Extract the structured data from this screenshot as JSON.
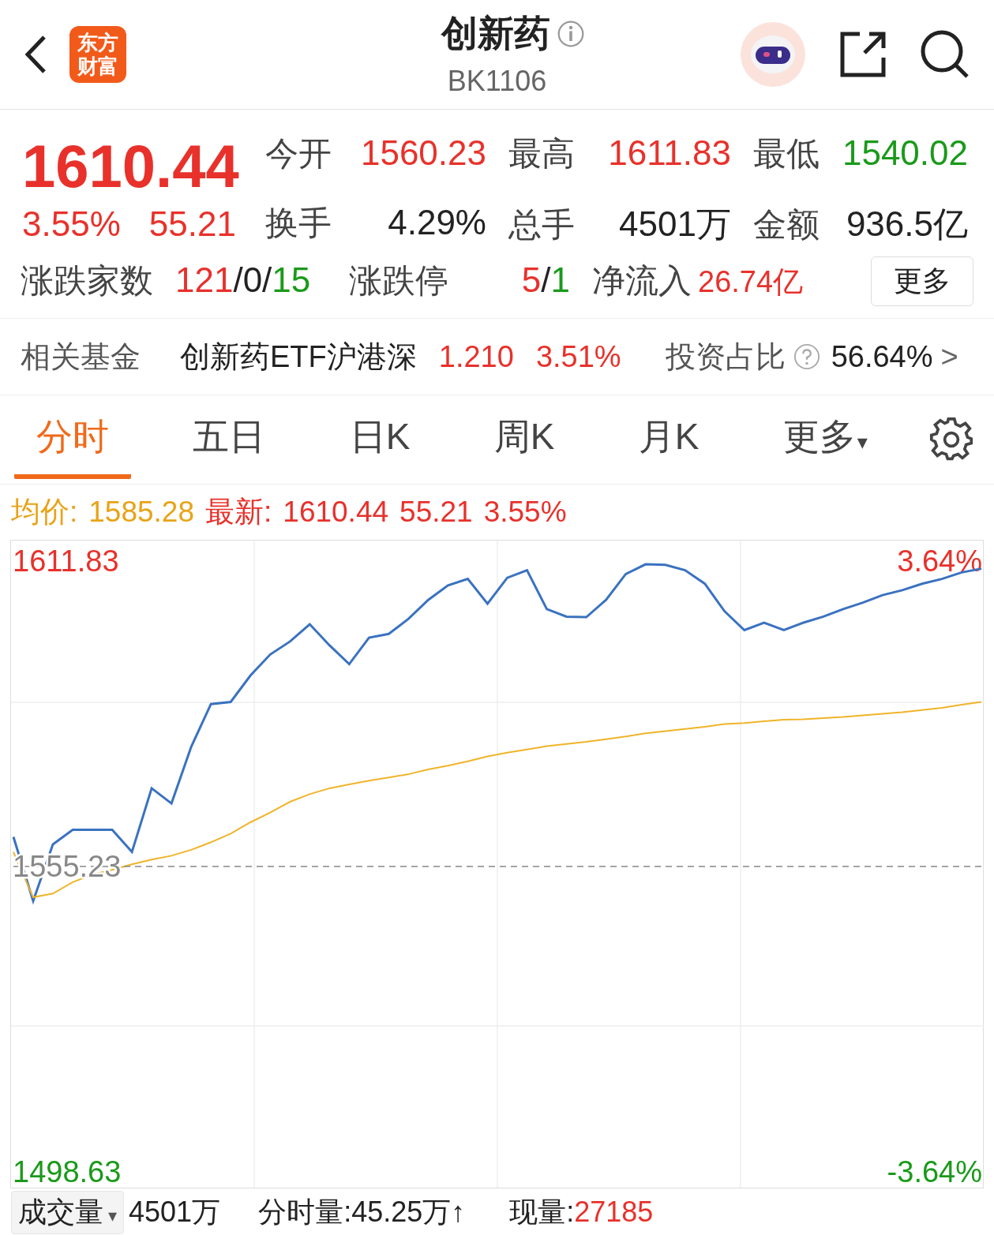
{
  "header": {
    "logo": [
      "东方",
      "财富"
    ],
    "title": "创新药",
    "code": "BK1106"
  },
  "quote": {
    "price": "1610.44",
    "change_pct": "3.55%",
    "change": "55.21",
    "stats": [
      [
        {
          "label": "今开",
          "parts": [
            {
              "text": "1560.23",
              "color": "#e8312b"
            }
          ]
        },
        {
          "label": "最高",
          "parts": [
            {
              "text": "1611.83",
              "color": "#e8312b"
            }
          ]
        },
        {
          "label": "最低",
          "parts": [
            {
              "text": "1540.02",
              "color": "#1a9a1a"
            }
          ]
        }
      ],
      [
        {
          "label": "换手",
          "parts": [
            {
              "text": "4.29%",
              "color": "#222222"
            }
          ]
        },
        {
          "label": "总手",
          "parts": [
            {
              "text": "4501万",
              "color": "#222222"
            }
          ]
        },
        {
          "label": "金额",
          "parts": [
            {
              "text": "936.5亿",
              "color": "#222222"
            }
          ]
        }
      ]
    ],
    "breadth": [
      {
        "label": "涨跌家数",
        "parts": [
          {
            "text": "121",
            "color": "#e8312b"
          },
          {
            "text": "/0/",
            "color": "#222222"
          },
          {
            "text": "15",
            "color": "#1a9a1a"
          }
        ]
      },
      {
        "label": "涨跌停",
        "parts": [
          {
            "text": "5",
            "color": "#e8312b"
          },
          {
            "text": "/",
            "color": "#222222"
          },
          {
            "text": "1",
            "color": "#1a9a1a"
          }
        ]
      },
      {
        "label": "净流入",
        "parts": [
          {
            "text": "26.74亿",
            "color": "#e8312b"
          }
        ]
      }
    ],
    "more_button": "更多"
  },
  "fund": {
    "label": "相关基金",
    "name": "创新药ETF沪港深",
    "price": "1.210",
    "change_pct": "3.51%",
    "ratio_label": "投资占比",
    "ratio": "56.64%",
    "arrow": ">"
  },
  "tabs": [
    {
      "label": "分时",
      "selected": true
    },
    {
      "label": "五日",
      "selected": false
    },
    {
      "label": "日K",
      "selected": false
    },
    {
      "label": "周K",
      "selected": false
    },
    {
      "label": "月K",
      "selected": false
    },
    {
      "label": "更多",
      "selected": false,
      "caret": "▾"
    }
  ],
  "legend": [
    {
      "text": "均价:",
      "kind": "avg"
    },
    {
      "text": "1585.28",
      "kind": "avg"
    },
    {
      "text": "最新:",
      "kind": "last"
    },
    {
      "text": "1610.44",
      "kind": "last"
    },
    {
      "text": "55.21",
      "kind": "last"
    },
    {
      "text": "3.55%",
      "kind": "last"
    }
  ],
  "chart_data": {
    "type": "line",
    "ylim": [
      1495.7,
      1615.6
    ],
    "yticks": [
      {
        "value": 1611.83,
        "label": "1611.83"
      },
      {
        "value": 1555.23,
        "label": "1555.23"
      },
      {
        "value": 1498.63,
        "label": "1498.63"
      }
    ],
    "annotations": [
      "3.64%",
      "-3.64%"
    ],
    "series": [
      {
        "color": "#3a72c0",
        "values": [
          1560.7,
          1548.8,
          1559.3,
          1562.0,
          1562.0,
          1562.0,
          1557.9,
          1569.7,
          1566.9,
          1577.4,
          1585.3,
          1585.7,
          1590.6,
          1594.5,
          1596.9,
          1600.1,
          1596.2,
          1592.7,
          1597.6,
          1598.3,
          1601.1,
          1604.6,
          1607.3,
          1608.5,
          1603.9,
          1608.7,
          1610.1,
          1602.9,
          1601.5,
          1601.4,
          1604.6,
          1609.4,
          1611.2,
          1611.1,
          1610.1,
          1607.6,
          1602.5,
          1599.0,
          1600.4,
          1599.0,
          1600.4,
          1601.5,
          1602.9,
          1604.1,
          1605.5,
          1606.4,
          1607.6,
          1608.5,
          1609.7,
          1610.4
        ]
      },
      {
        "color": "#f0b429",
        "values": [
          1557.9,
          1549.5,
          1550.2,
          1552.3,
          1553.7,
          1554.6,
          1555.6,
          1556.5,
          1557.2,
          1558.3,
          1559.7,
          1561.3,
          1563.4,
          1565.2,
          1567.2,
          1568.6,
          1569.7,
          1570.4,
          1571.1,
          1571.7,
          1572.3,
          1573.2,
          1573.9,
          1574.7,
          1575.6,
          1576.3,
          1576.9,
          1577.5,
          1577.9,
          1578.3,
          1578.8,
          1579.3,
          1579.9,
          1580.3,
          1580.7,
          1581.1,
          1581.6,
          1581.8,
          1582.1,
          1582.4,
          1582.5,
          1582.7,
          1582.9,
          1583.2,
          1583.5,
          1583.8,
          1584.2,
          1584.6,
          1585.2,
          1585.7
        ]
      },
      {
        "color": "#888888",
        "line_style": "dashed",
        "values": [
          1555.23,
          1555.23,
          1555.23,
          1555.23,
          1555.23,
          1555.23,
          1555.23,
          1555.23,
          1555.23,
          1555.23,
          1555.23,
          1555.23,
          1555.23,
          1555.23,
          1555.23,
          1555.23,
          1555.23,
          1555.23,
          1555.23,
          1555.23,
          1555.23,
          1555.23,
          1555.23,
          1555.23,
          1555.23,
          1555.23,
          1555.23,
          1555.23,
          1555.23,
          1555.23,
          1555.23,
          1555.23,
          1555.23,
          1555.23,
          1555.23,
          1555.23,
          1555.23,
          1555.23,
          1555.23,
          1555.23,
          1555.23,
          1555.23,
          1555.23,
          1555.23,
          1555.23,
          1555.23,
          1555.23,
          1555.23,
          1555.23,
          1555.23
        ]
      }
    ]
  },
  "volume_bar": {
    "dropdown": "成交量",
    "caret": "▾",
    "total": "4501万",
    "minute_volume": "分时量:45.25万↑",
    "current_label": "现量:",
    "current_value": "27185"
  }
}
